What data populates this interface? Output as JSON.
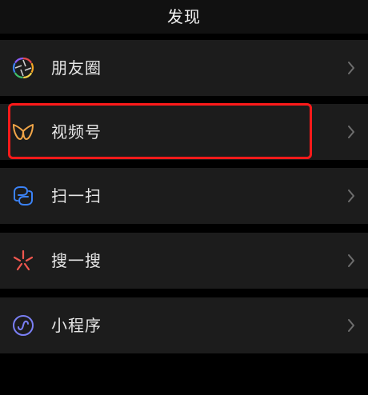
{
  "header": {
    "title": "发现"
  },
  "menu": {
    "items": [
      {
        "label": "朋友圈",
        "icon": "moments-icon"
      },
      {
        "label": "视频号",
        "icon": "channels-icon"
      },
      {
        "label": "扫一扫",
        "icon": "scan-icon"
      },
      {
        "label": "搜一搜",
        "icon": "search-icon"
      },
      {
        "label": "小程序",
        "icon": "mini-program-icon"
      }
    ]
  },
  "colors": {
    "background": "#000000",
    "cell": "#1c1c1c",
    "text": "#e6e6e6",
    "chevron": "#6e6e6e",
    "highlight": "#ff1a1a",
    "channels_accent": "#f2a648",
    "scan_accent": "#3b82f6",
    "search_accent": "#f0574f",
    "mini_program_accent": "#7a7ff5"
  }
}
